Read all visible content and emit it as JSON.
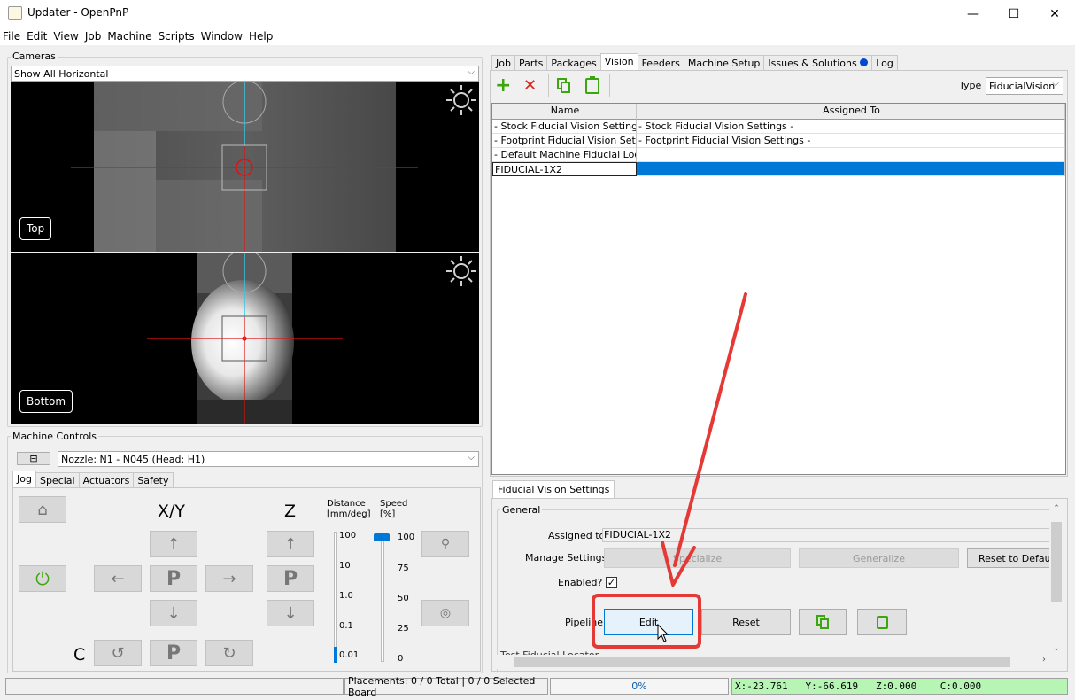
{
  "window": {
    "title": "Updater - OpenPnP",
    "minimize": "—",
    "maximize": "☐",
    "close": "✕"
  },
  "menu": [
    "File",
    "Edit",
    "View",
    "Job",
    "Machine",
    "Scripts",
    "Window",
    "Help"
  ],
  "cameras": {
    "title": "Cameras",
    "layout": "Show All Horizontal",
    "top_label": "Top",
    "bottom_label": "Bottom"
  },
  "machine_controls": {
    "title": "Machine Controls",
    "collapse": "⊟",
    "nozzle": "Nozzle: N1 - N045 (Head: H1)",
    "tabs": [
      "Jog",
      "Special",
      "Actuators",
      "Safety"
    ],
    "active_tab": "Jog",
    "xy_label": "X/Y",
    "z_label": "Z",
    "c_label": "C",
    "distance_label": "Distance",
    "distance_unit": "[mm/deg]",
    "distance_values": [
      "100",
      "10",
      "1.0",
      "0.1",
      "0.01"
    ],
    "speed_label": "Speed",
    "speed_unit": "[%]",
    "speed_values": [
      "100",
      "75",
      "50",
      "25",
      "0"
    ],
    "park": "P"
  },
  "tabs": [
    "Job",
    "Parts",
    "Packages",
    "Vision",
    "Feeders",
    "Machine Setup",
    "Issues & Solutions",
    "Log"
  ],
  "active_tab": "Vision",
  "vision": {
    "type_label": "Type",
    "type_value": "FiducialVision",
    "columns": [
      "Name",
      "Assigned To"
    ],
    "rows": [
      {
        "name": "- Stock Fiducial Vision Settings -",
        "assigned": "- Stock Fiducial Vision Settings -"
      },
      {
        "name": "- Footprint Fiducial Vision Setti...",
        "assigned": "- Footprint Fiducial Vision Settings -"
      },
      {
        "name": "- Default Machine Fiducial Loca...",
        "assigned": ""
      },
      {
        "name": "FIDUCIAL-1X2",
        "assigned": ""
      }
    ]
  },
  "settings": {
    "tab": "Fiducial Vision Settings",
    "section": "General",
    "assigned_label": "Assigned to",
    "assigned_value": "FIDUCIAL-1X2",
    "manage_label": "Manage Settings",
    "specialize": "Specialize",
    "generalize": "Generalize",
    "reset_default": "Reset to Default",
    "enabled_label": "Enabled?",
    "enabled": true,
    "pipeline_label": "Pipeline",
    "edit": "Edit",
    "reset": "Reset",
    "next_section": "Test Fiducial Locator"
  },
  "status": {
    "placements": "Placements: 0 / 0 Total | 0 / 0 Selected Board",
    "progress": "0%",
    "dro": "X:-23.761   Y:-66.619   Z:0.000    C:0.000"
  },
  "colors": {
    "accent": "#0078d7",
    "annotation": "#e53935",
    "dro_bg": "#b7f5b4",
    "green_icon": "#3ca60e",
    "red_icon": "#d9261c"
  }
}
